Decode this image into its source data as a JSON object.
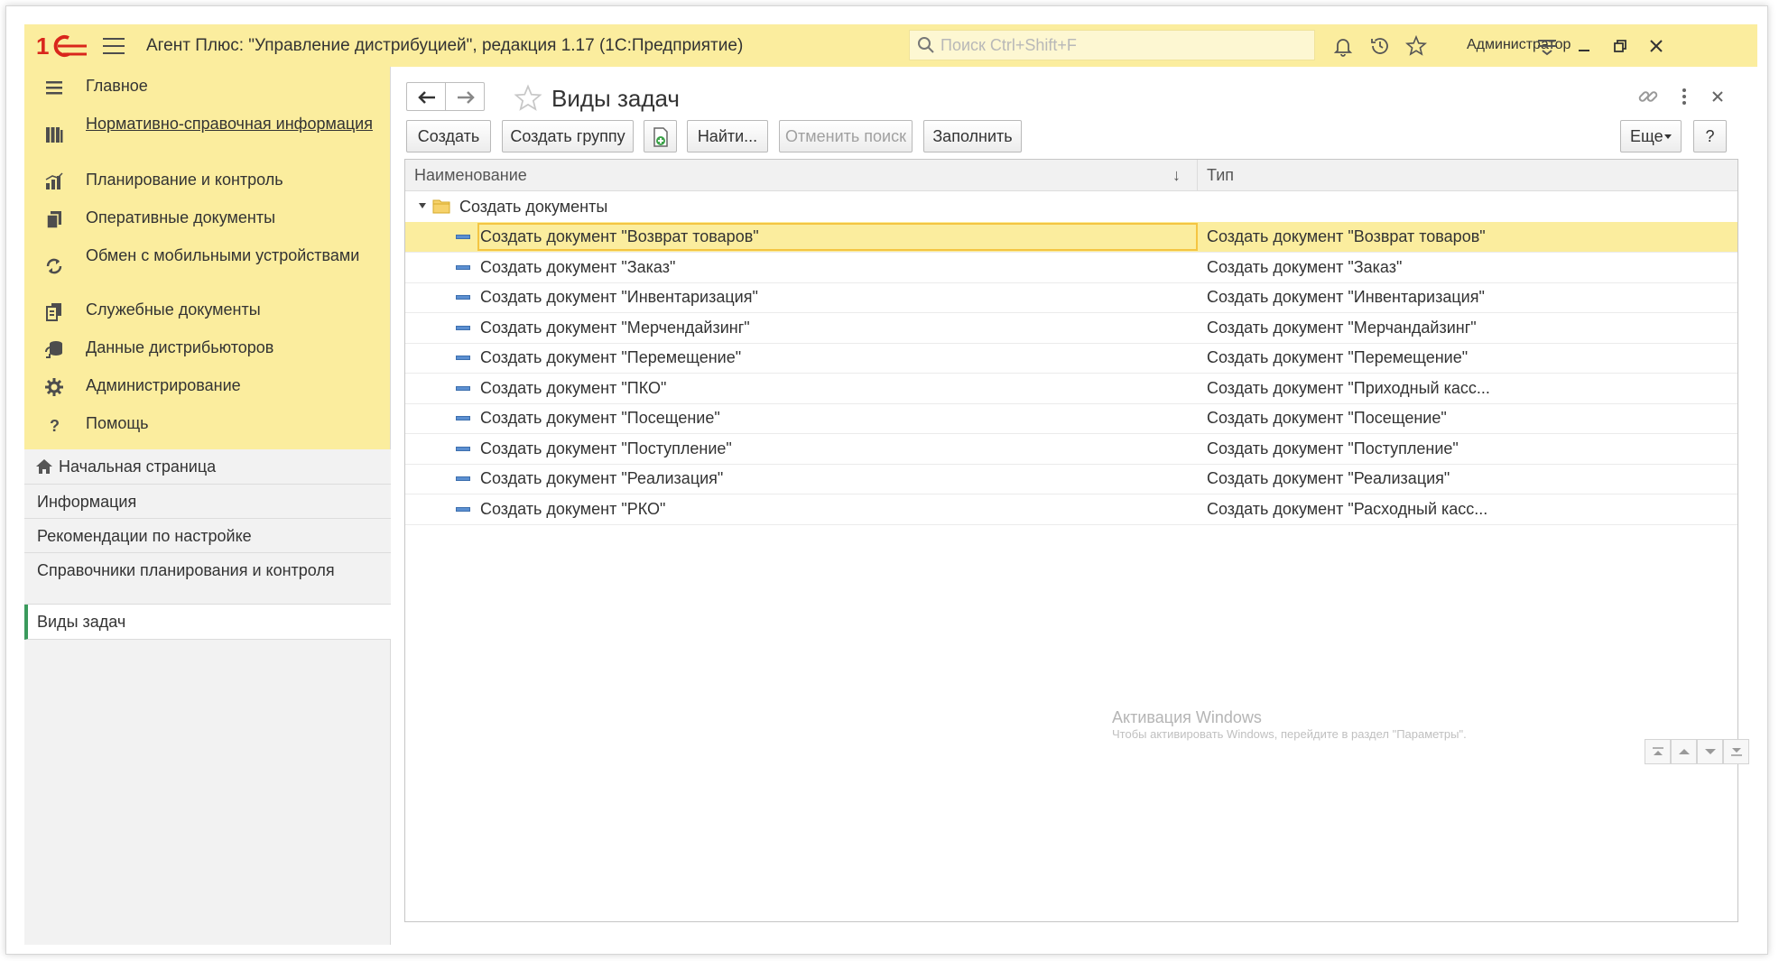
{
  "titlebar": {
    "app_title": "Агент Плюс: \"Управление дистрибуцией\", редакция 1.17  (1С:Предприятие)",
    "search_placeholder": "Поиск Ctrl+Shift+F",
    "user_name": "Администратор"
  },
  "sidebar": {
    "sections": [
      {
        "label": "Главное",
        "icon": "menu-lines-icon"
      },
      {
        "label": "Нормативно-справочная информация",
        "icon": "books-icon"
      },
      {
        "label": "Планирование и контроль",
        "icon": "bar-chart-icon"
      },
      {
        "label": "Оперативные документы",
        "icon": "documents-icon"
      },
      {
        "label": "Обмен с мобильными устройствами",
        "icon": "sync-icon"
      },
      {
        "label": "Служебные документы",
        "icon": "service-documents-icon"
      },
      {
        "label": "Данные дистрибьюторов",
        "icon": "distributor-data-icon"
      },
      {
        "label": "Администрирование",
        "icon": "gear-icon"
      },
      {
        "label": "Помощь",
        "icon": "question-icon"
      }
    ],
    "open_pages": [
      {
        "label": "Начальная страница"
      },
      {
        "label": "Информация"
      },
      {
        "label": "Рекомендации по настройке"
      },
      {
        "label": "Справочники планирования и контроля"
      },
      {
        "label": "Виды задач"
      }
    ]
  },
  "main": {
    "title": "Виды задач",
    "toolbar": {
      "create": "Создать",
      "create_group": "Создать группу",
      "find": "Найти...",
      "cancel_search": "Отменить поиск",
      "fill": "Заполнить",
      "more": "Еще",
      "help": "?"
    },
    "table": {
      "columns": [
        "Наименование",
        "Тип"
      ],
      "group": "Создать документы",
      "rows": [
        {
          "name": "Создать документ \"Возврат товаров\"",
          "type": "Создать документ \"Возврат товаров\""
        },
        {
          "name": "Создать документ \"Заказ\"",
          "type": "Создать документ \"Заказ\""
        },
        {
          "name": "Создать документ \"Инвентаризация\"",
          "type": "Создать документ \"Инвентаризация\""
        },
        {
          "name": "Создать документ \"Мерчендайзинг\"",
          "type": "Создать документ \"Мерчандайзинг\""
        },
        {
          "name": "Создать документ \"Перемещение\"",
          "type": "Создать документ \"Перемещение\""
        },
        {
          "name": "Создать документ \"ПКО\"",
          "type": "Создать документ \"Приходный касс..."
        },
        {
          "name": "Создать документ \"Посещение\"",
          "type": "Создать документ \"Посещение\""
        },
        {
          "name": "Создать документ \"Поступление\"",
          "type": "Создать документ \"Поступление\""
        },
        {
          "name": "Создать документ \"Реализация\"",
          "type": "Создать документ \"Реализация\""
        },
        {
          "name": "Создать документ \"РКО\"",
          "type": "Создать документ \"Расходный касс..."
        }
      ]
    },
    "watermark": {
      "title": "Активация Windows",
      "subtitle": "Чтобы активировать Windows, перейдите в раздел \"Параметры\"."
    }
  },
  "colors": {
    "accent_yellow": "#fbed9e",
    "selection_border": "#f4c542",
    "active_page_marker": "#3a9a5c",
    "logo_red": "#d9261c"
  }
}
